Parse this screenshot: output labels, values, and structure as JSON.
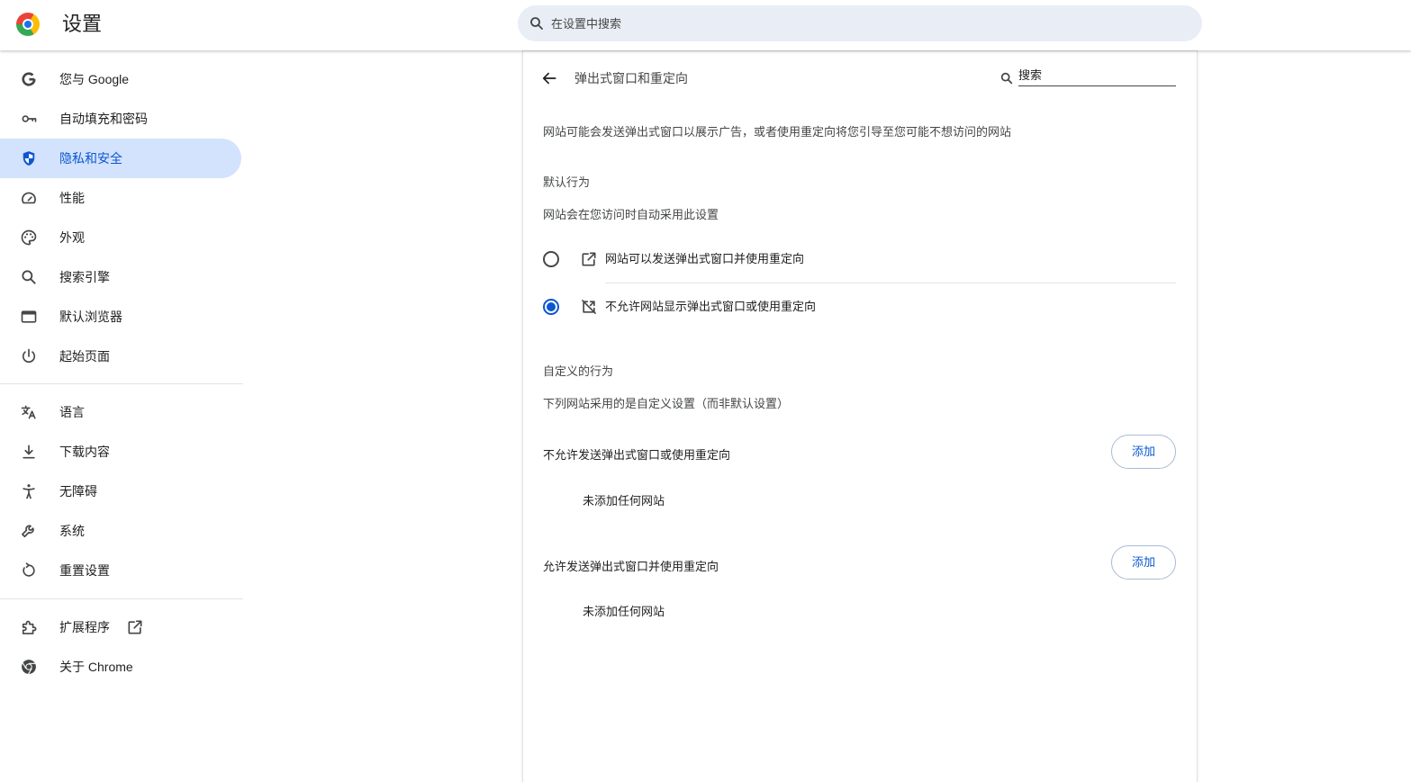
{
  "colors": {
    "accent": "#0b57d0",
    "nav_active_bg": "#d3e3fd",
    "search_bg": "#e9eef6",
    "text_primary": "#1f1f1f",
    "text_secondary": "#444746"
  },
  "header": {
    "logo_icon": "chrome-logo-icon",
    "title": "设置",
    "search_icon": "search-icon",
    "search_placeholder": "在设置中搜索"
  },
  "sidebar": {
    "items": [
      {
        "label": "您与 Google",
        "icon": "google-g-icon",
        "active": false
      },
      {
        "label": "自动填充和密码",
        "icon": "key-icon",
        "active": false
      },
      {
        "label": "隐私和安全",
        "icon": "shield-icon",
        "active": true
      },
      {
        "label": "性能",
        "icon": "speedometer-icon",
        "active": false
      },
      {
        "label": "外观",
        "icon": "palette-icon",
        "active": false
      },
      {
        "label": "搜索引擎",
        "icon": "search-icon",
        "active": false
      },
      {
        "label": "默认浏览器",
        "icon": "browser-window-icon",
        "active": false
      },
      {
        "label": "起始页面",
        "icon": "power-icon",
        "active": false
      },
      {
        "label": "语言",
        "icon": "translate-icon",
        "active": false
      },
      {
        "label": "下载内容",
        "icon": "download-icon",
        "active": false
      },
      {
        "label": "无障碍",
        "icon": "accessibility-icon",
        "active": false
      },
      {
        "label": "系统",
        "icon": "wrench-icon",
        "active": false
      },
      {
        "label": "重置设置",
        "icon": "restore-icon",
        "active": false
      },
      {
        "label": "扩展程序",
        "icon": "puzzle-icon",
        "trailing_icon": "external-link-icon",
        "active": false
      },
      {
        "label": "关于 Chrome",
        "icon": "chrome-icon",
        "active": false
      }
    ]
  },
  "page": {
    "back_icon": "back-arrow-icon",
    "title": "弹出式窗口和重定向",
    "search_icon": "search-icon",
    "search_placeholder": "搜索",
    "description": "网站可能会发送弹出式窗口以展示广告，或者使用重定向将您引导至您可能不想访问的网站",
    "default_behavior": {
      "heading": "默认行为",
      "subheading": "网站会在您访问时自动采用此设置",
      "options": [
        {
          "label": "网站可以发送弹出式窗口并使用重定向",
          "icon": "open-in-new-icon",
          "selected": false
        },
        {
          "label": "不允许网站显示弹出式窗口或使用重定向",
          "icon": "popup-blocked-icon",
          "selected": true
        }
      ]
    },
    "custom_behavior": {
      "heading": "自定义的行为",
      "subheading": "下列网站采用的是自定义设置（而非默认设置）",
      "lists": [
        {
          "title": "不允许发送弹出式窗口或使用重定向",
          "add_label": "添加",
          "empty_text": "未添加任何网站"
        },
        {
          "title": "允许发送弹出式窗口并使用重定向",
          "add_label": "添加",
          "empty_text": "未添加任何网站"
        }
      ]
    }
  }
}
